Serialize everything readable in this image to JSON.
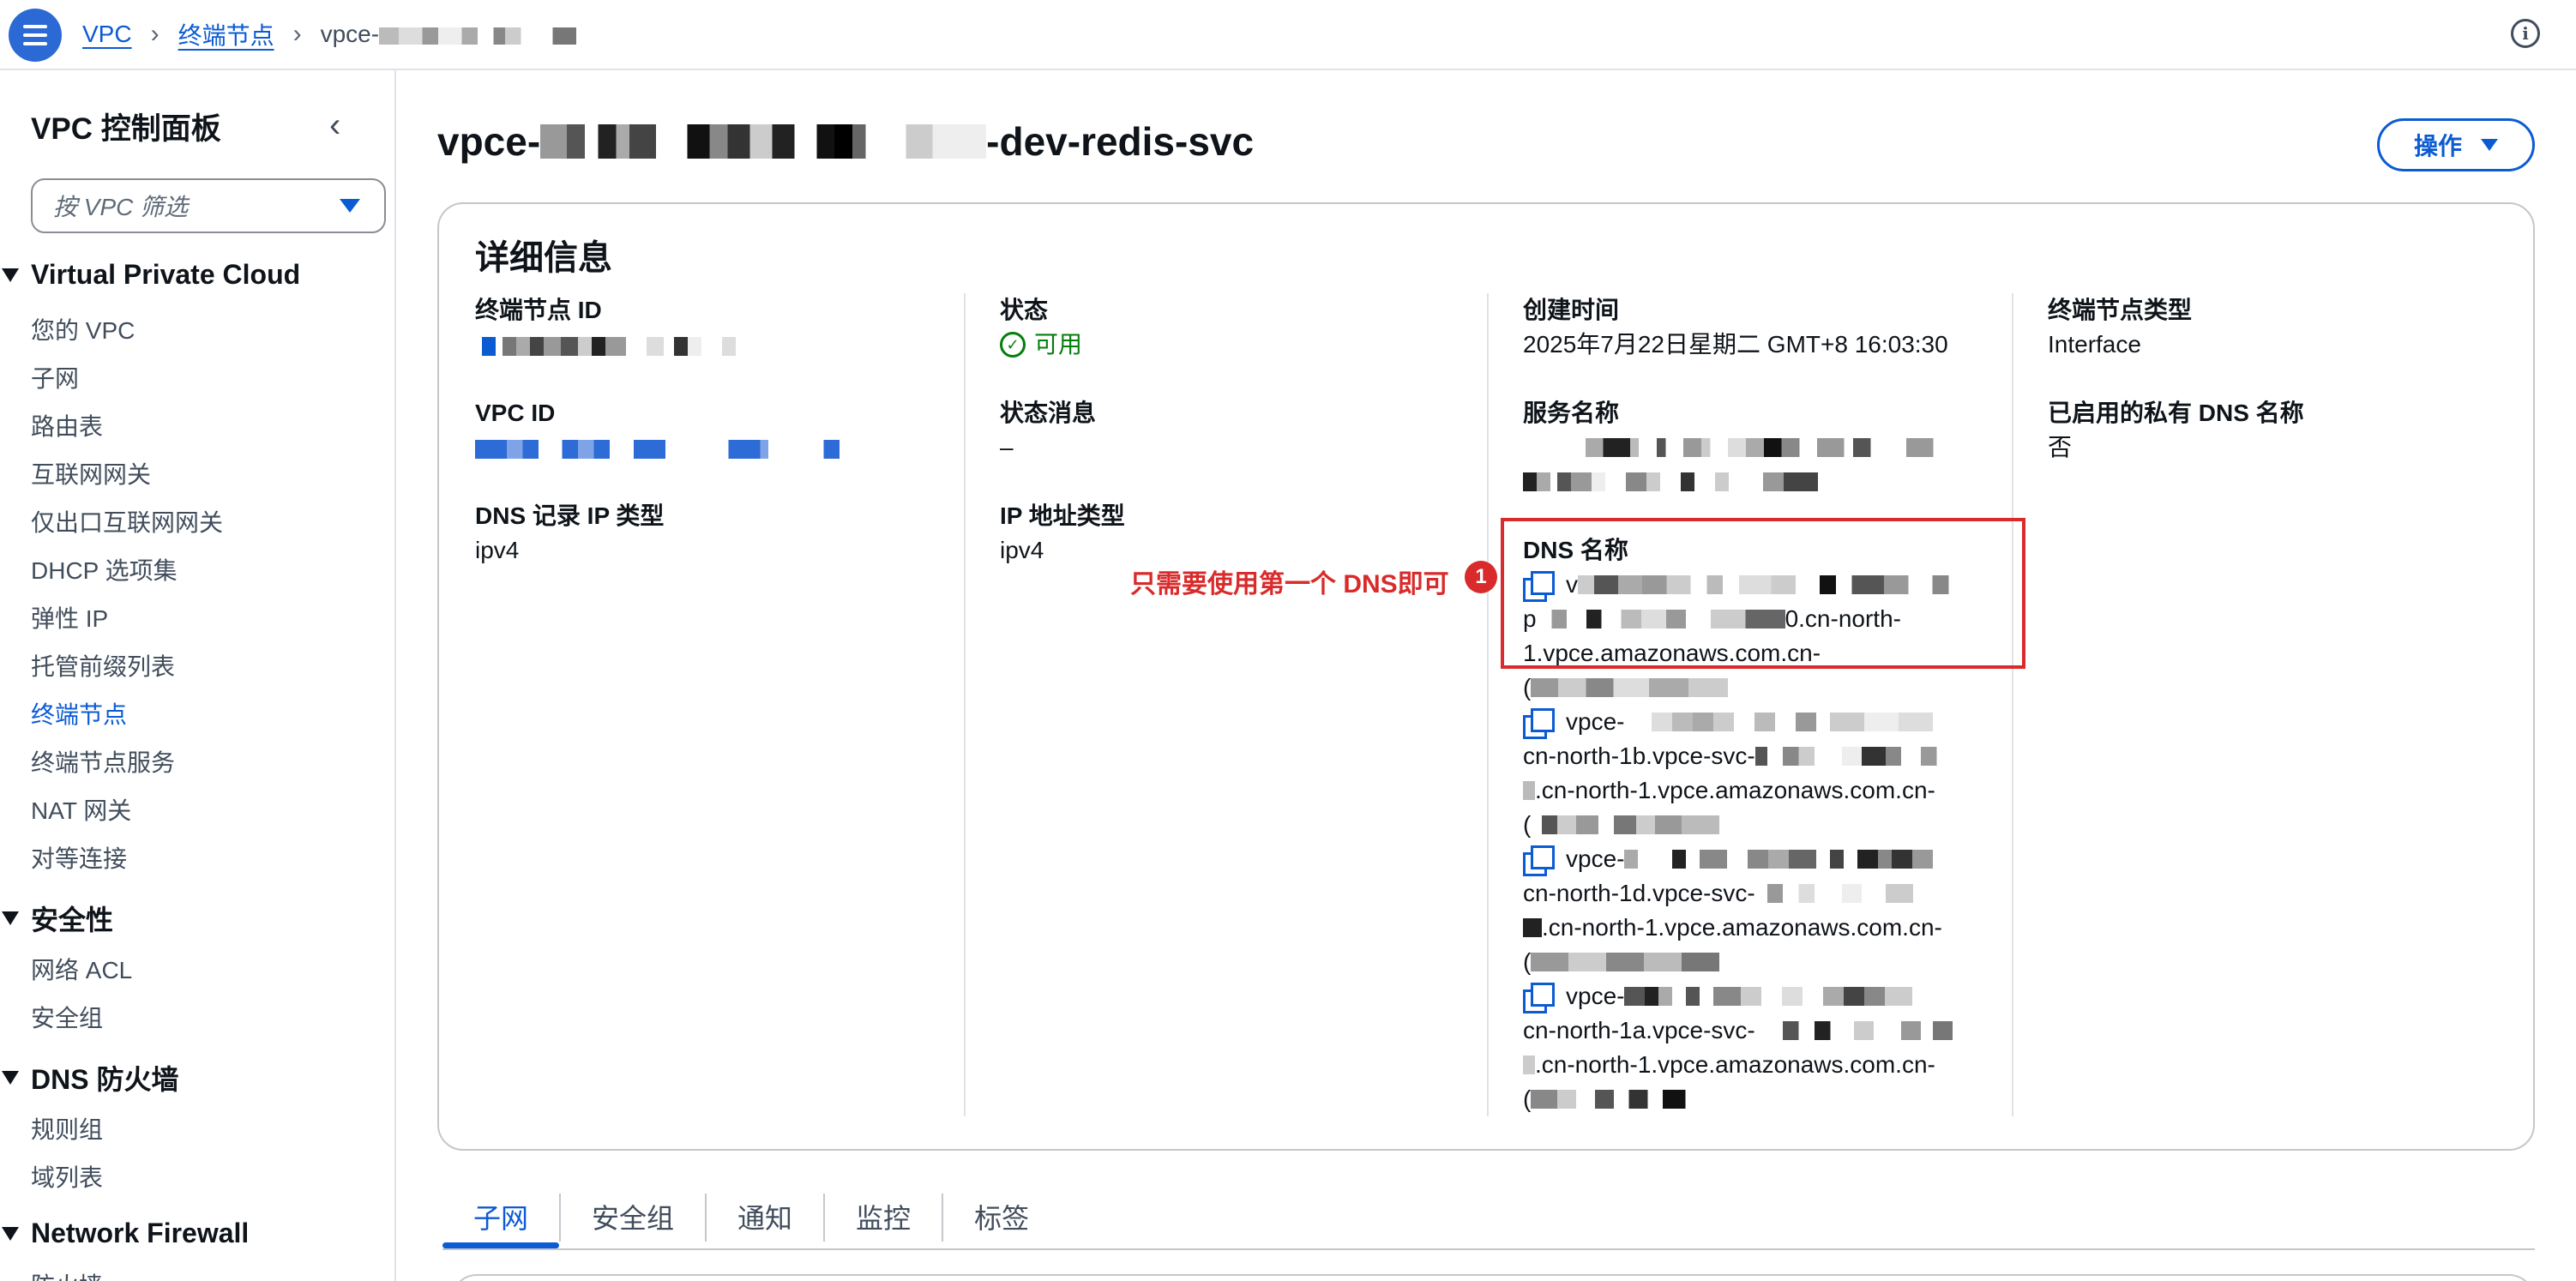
{
  "breadcrumb": {
    "items": [
      "VPC",
      "终端节点"
    ],
    "current_prefix": "vpce-"
  },
  "sidebar": {
    "title": "VPC 控制面板",
    "filter_placeholder": "按 VPC 筛选",
    "sections": [
      {
        "title": "Virtual Private Cloud",
        "items": [
          "您的 VPC",
          "子网",
          "路由表",
          "互联网网关",
          "仅出口互联网网关",
          "DHCP 选项集",
          "弹性 IP",
          "托管前缀列表",
          "终端节点",
          "终端节点服务",
          "NAT 网关",
          "对等连接"
        ]
      },
      {
        "title": "安全性",
        "items": [
          "网络 ACL",
          "安全组"
        ]
      },
      {
        "title": "DNS 防火墙",
        "items": [
          "规则组",
          "域列表"
        ]
      },
      {
        "title": "Network Firewall",
        "items": [
          "防火墙"
        ]
      }
    ],
    "active_item": "终端节点"
  },
  "page": {
    "title_prefix": "vpce-",
    "title_suffix": "-dev-redis-svc",
    "actions_label": "操作"
  },
  "details": {
    "title": "详细信息",
    "endpoint_id_label": "终端节点 ID",
    "vpc_id_label": "VPC ID",
    "dns_record_ip_type_label": "DNS 记录 IP 类型",
    "dns_record_ip_type_value": "ipv4",
    "status_label": "状态",
    "status_value": "可用",
    "status_message_label": "状态消息",
    "status_message_value": "–",
    "ip_address_type_label": "IP 地址类型",
    "ip_address_type_value": "ipv4",
    "created_label": "创建时间",
    "created_value": "2025年7月22日星期二 GMT+8 16:03:30",
    "service_name_label": "服务名称",
    "dns_names_label": "DNS 名称",
    "dns_names": [
      {
        "l1": "v",
        "l2": "p",
        "l2_tail": "0.cn-north-",
        "l3": "1.vpce.amazonaws.com.cn-",
        "l4": "("
      },
      {
        "l1": "vpce-",
        "l2": "cn-north-1b.vpce-svc-",
        "l3": ".cn-north-1.vpce.amazonaws.com.cn-",
        "l4": "("
      },
      {
        "l1": "vpce-",
        "l2": "cn-north-1d.vpce-svc-",
        "l3": ".cn-north-1.vpce.amazonaws.com.cn-",
        "l4": "("
      },
      {
        "l1": "vpce-",
        "l2": "cn-north-1a.vpce-svc-",
        "l3": ".cn-north-1.vpce.amazonaws.com.cn-",
        "l4": "("
      }
    ],
    "endpoint_type_label": "终端节点类型",
    "endpoint_type_value": "Interface",
    "private_dns_label": "已启用的私有 DNS 名称",
    "private_dns_value": "否"
  },
  "annotation": {
    "text": "只需要使用第一个 DNS即可",
    "badge": "1",
    "color": "#d92b2b"
  },
  "tabs": [
    "子网",
    "安全组",
    "通知",
    "监控",
    "标签"
  ],
  "active_tab": "子网",
  "colors": {
    "accent": "#0b5bd3",
    "success": "#037f0c",
    "annotation": "#d92b2b"
  }
}
